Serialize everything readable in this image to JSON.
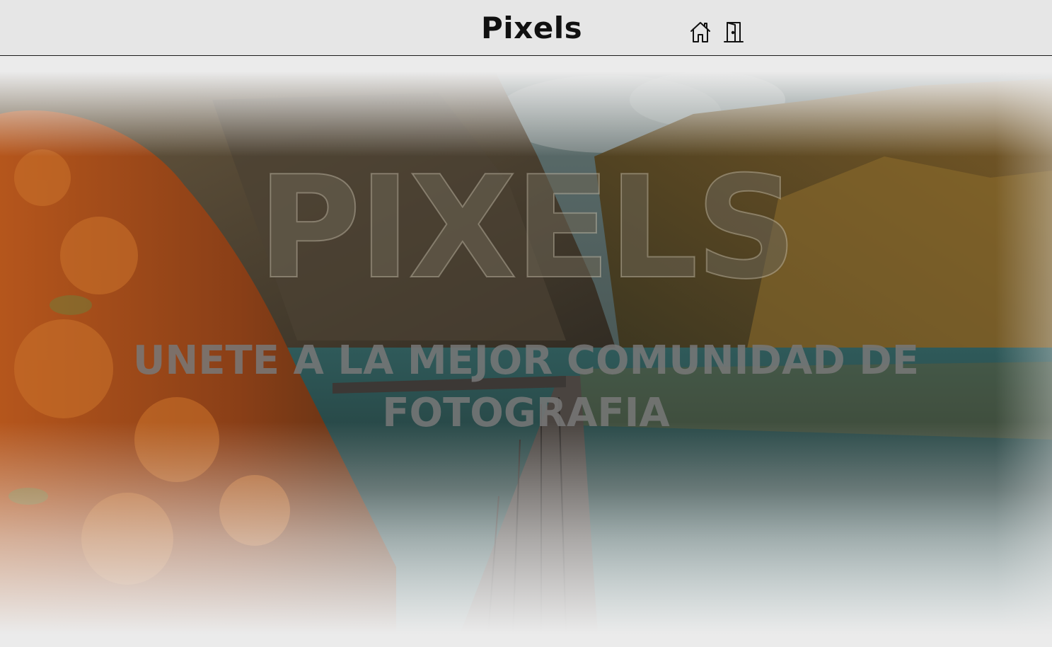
{
  "header": {
    "brand": "Pixels",
    "icons": [
      "home-icon",
      "door-exit-icon"
    ]
  },
  "hero": {
    "title": "PIXELS",
    "subtitle": "UNETE A LA MEJOR COMUNIDAD DE FOTOGRAFIA",
    "background": "mountain lake with wooden pier and autumn foliage"
  },
  "colors": {
    "header_bg": "#e6e6e6",
    "page_bg": "#ebebeb",
    "foliage": "#b5561c",
    "water": "#2e6a6e",
    "subtitle": "#787878"
  }
}
